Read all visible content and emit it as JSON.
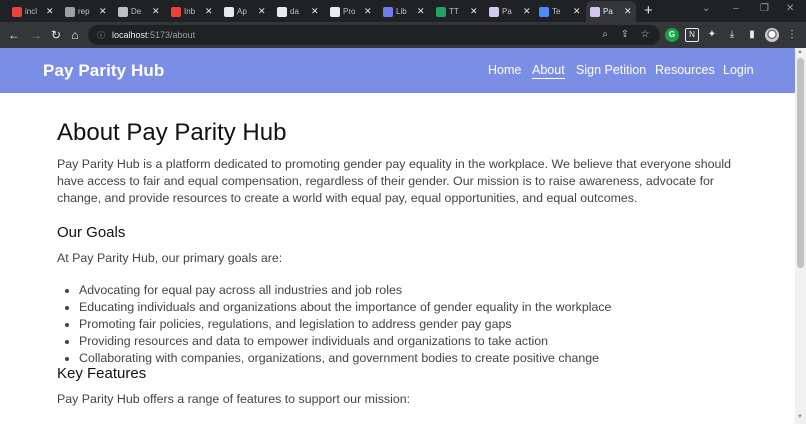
{
  "browser": {
    "tabs": [
      {
        "title": "incl",
        "favicon_color": "#e8453c"
      },
      {
        "title": "rep",
        "favicon_color": "#9aa0a6"
      },
      {
        "title": "De",
        "favicon_color": "#bdc1c6"
      },
      {
        "title": "Inb",
        "favicon_color": "#ea4335"
      },
      {
        "title": "Ap",
        "favicon_color": "#e8eaed"
      },
      {
        "title": "da",
        "favicon_color": "#e8eaed"
      },
      {
        "title": "Pro",
        "favicon_color": "#e8eaed"
      },
      {
        "title": "Lib",
        "favicon_color": "#6f7cf0"
      },
      {
        "title": "TT",
        "favicon_color": "#1fa463"
      },
      {
        "title": "Pa",
        "favicon_color": "#d6c7f0"
      },
      {
        "title": "Te",
        "favicon_color": "#4b8cf5"
      },
      {
        "title": "Pa",
        "favicon_color": "#d6c7f0"
      }
    ],
    "new_tab_label": "+",
    "url_host": "localhost",
    "url_path": ":5173/about"
  },
  "site": {
    "brand": "Pay Parity Hub",
    "nav": [
      "Home",
      "About",
      "Sign Petition",
      "Resources",
      "Login"
    ],
    "active_nav": "About"
  },
  "page": {
    "title": "About Pay Parity Hub",
    "intro": "Pay Parity Hub is a platform dedicated to promoting gender pay equality in the workplace. We believe that everyone should have access to fair and equal compensation, regardless of their gender. Our mission is to raise awareness, advocate for change, and provide resources to create a world with equal pay, equal opportunities, and equal outcomes.",
    "goals_heading": "Our Goals",
    "goals_intro": "At Pay Parity Hub, our primary goals are:",
    "goals": [
      "Advocating for equal pay across all industries and job roles",
      "Educating individuals and organizations about the importance of gender equality in the workplace",
      "Promoting fair policies, regulations, and legislation to address gender pay gaps",
      "Providing resources and data to empower individuals and organizations to take action",
      "Collaborating with companies, organizations, and government bodies to create positive change"
    ],
    "features_heading": "Key Features",
    "features_intro": "Pay Parity Hub offers a range of features to support our mission:"
  },
  "colors": {
    "header_bg": "#7b8ee5",
    "tabbar_bg": "#202124",
    "toolbar_bg": "#35363a"
  }
}
